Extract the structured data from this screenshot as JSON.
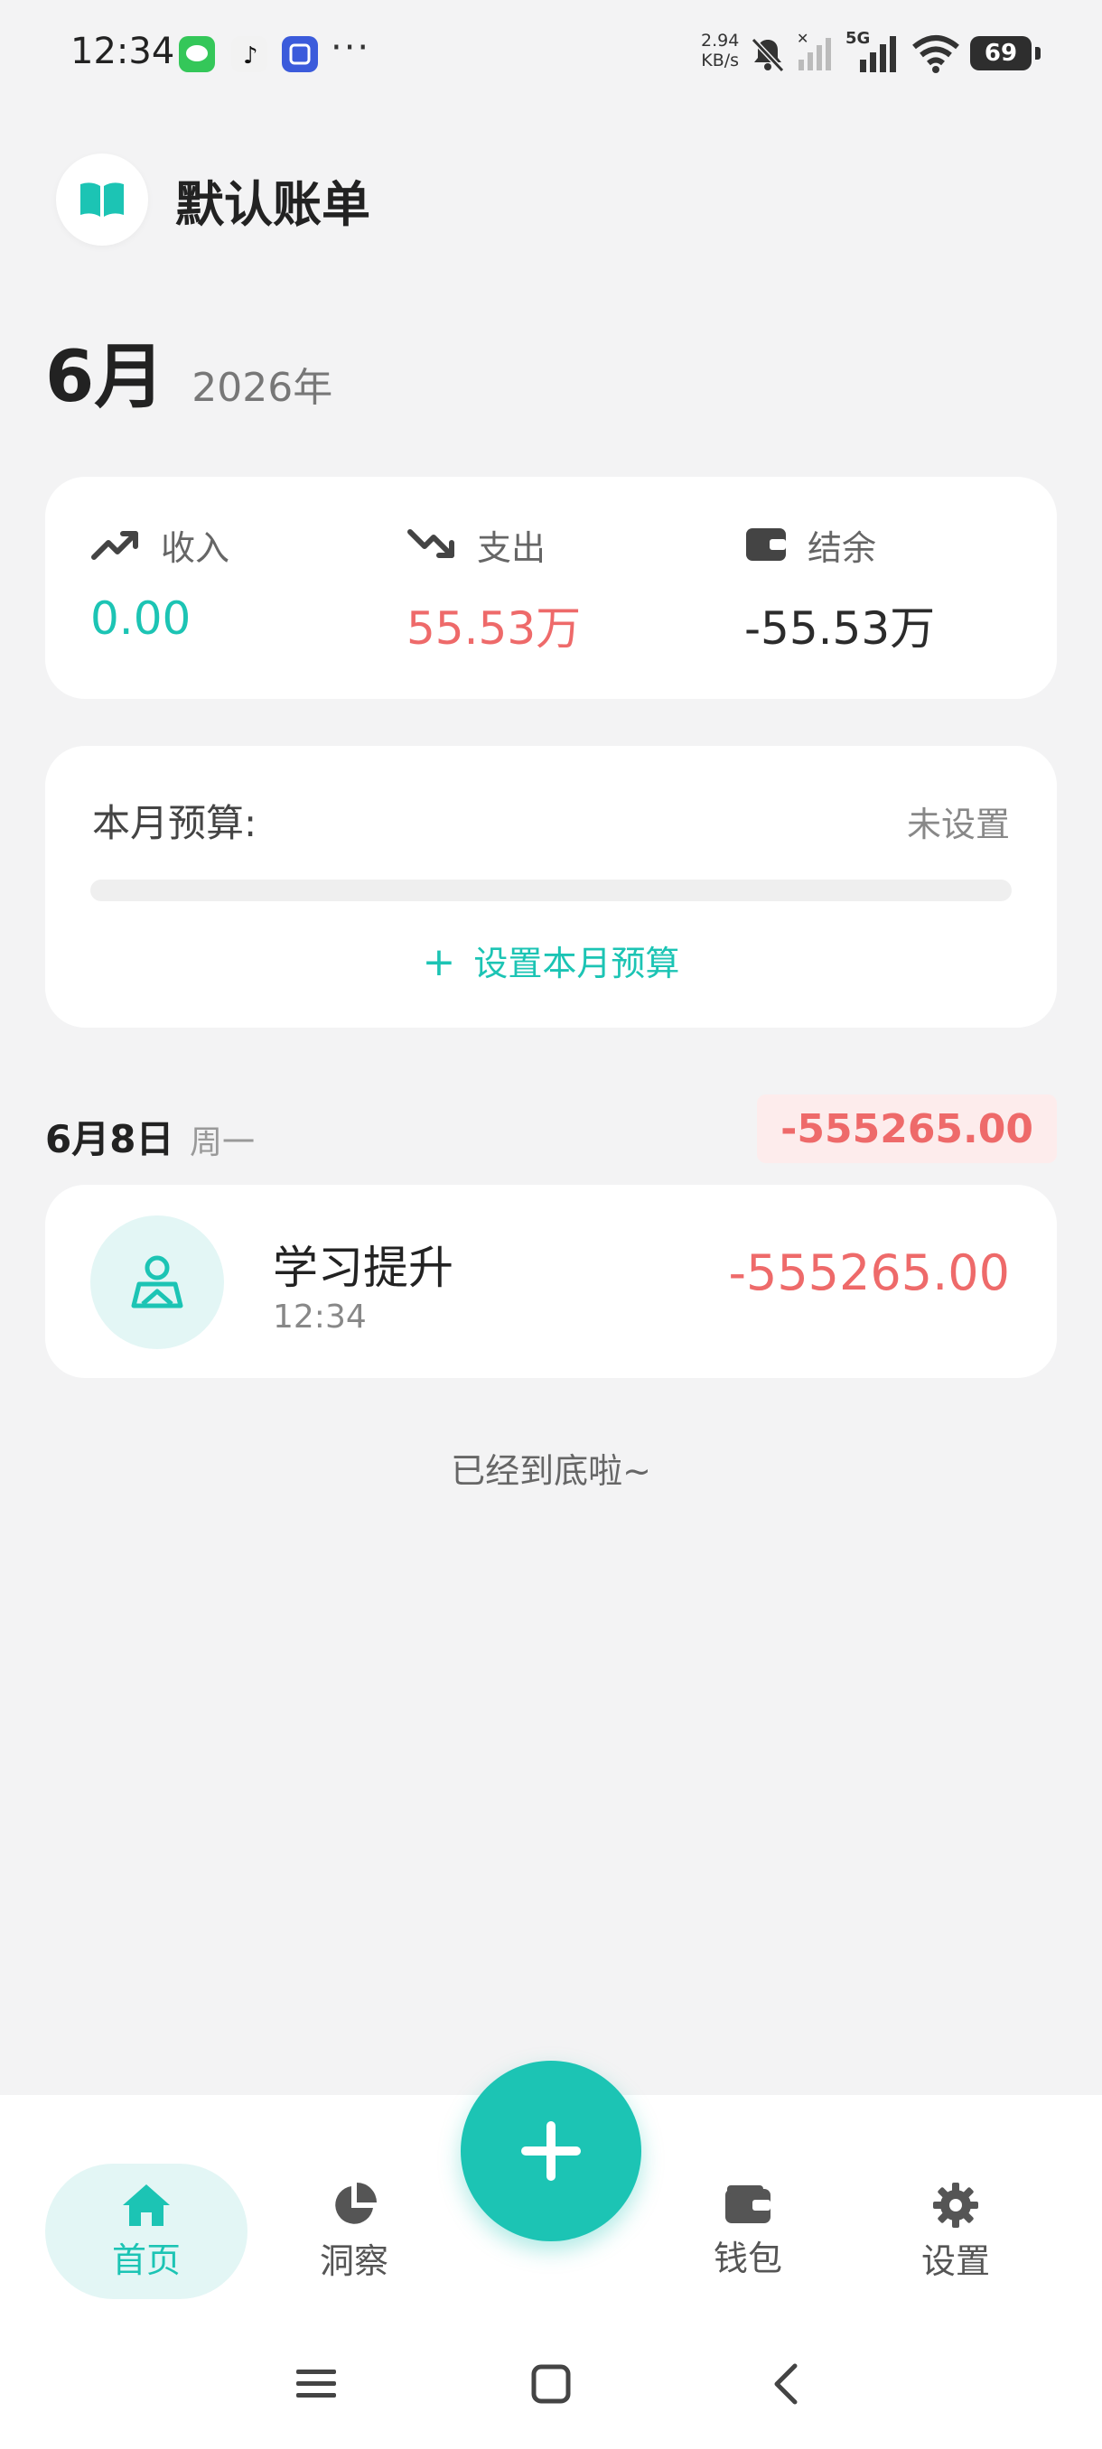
{
  "status_bar": {
    "time": "12:34",
    "more": "···",
    "net_speed_value": "2.94",
    "net_speed_unit": "KB/s",
    "signal_label": "5G",
    "battery": "69",
    "apps": [
      {
        "icon": "messages-icon",
        "color": "#34c759"
      },
      {
        "icon": "tiktok-icon",
        "color": "#111111"
      },
      {
        "icon": "tieba-icon",
        "color": "#3b5bdb"
      }
    ]
  },
  "header": {
    "book_title": "默认账单",
    "month": "6月",
    "year": "2026年"
  },
  "summary": {
    "income_label": "收入",
    "income_value": "0.00",
    "expense_label": "支出",
    "expense_value": "55.53万",
    "balance_label": "结余",
    "balance_value": "-55.53万"
  },
  "budget": {
    "title": "本月预算:",
    "status": "未设置",
    "progress": 0,
    "action": "设置本月预算"
  },
  "day_group": {
    "date": "6月8日",
    "weekday": "周一",
    "total": "-555265.00"
  },
  "transactions": [
    {
      "category": "学习提升",
      "time": "12:34",
      "amount": "-555265.00",
      "icon": "person-icon"
    }
  ],
  "list_end_text": "已经到底啦~",
  "bottom_nav": {
    "home": "首页",
    "insight": "洞察",
    "wallet": "钱包",
    "settings": "设置"
  },
  "colors": {
    "accent": "#1cc4b4",
    "expense": "#ee6a6a",
    "background": "#f3f3f4"
  }
}
